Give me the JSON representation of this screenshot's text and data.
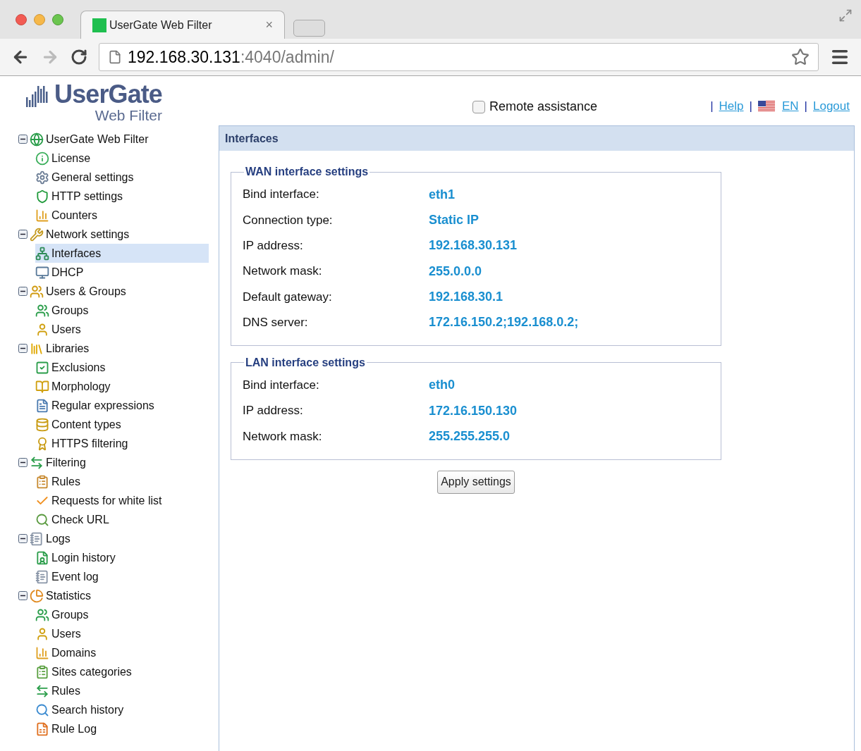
{
  "browser": {
    "tab_title": "UserGate Web Filter",
    "tab_close": "×",
    "url_host": "192.168.30.131",
    "url_rest": ":4040/admin/"
  },
  "logo": {
    "name": "UserGate",
    "subtitle": "Web Filter"
  },
  "header": {
    "remote_assistance": {
      "label": "Remote assistance",
      "checked": false
    },
    "links": [
      {
        "kind": "link",
        "label": "Help"
      },
      {
        "kind": "flag-link",
        "label": "EN"
      },
      {
        "kind": "link",
        "label": "Logout"
      }
    ],
    "separator": "|"
  },
  "tree": [
    {
      "label": "UserGate Web Filter",
      "expanded": true,
      "selected": false,
      "children": [
        {
          "label": "License",
          "selected": false
        },
        {
          "label": "General settings",
          "selected": false
        },
        {
          "label": "HTTP settings",
          "selected": false
        },
        {
          "label": "Counters",
          "selected": false
        }
      ]
    },
    {
      "label": "Network settings",
      "expanded": true,
      "selected": false,
      "children": [
        {
          "label": "Interfaces",
          "selected": true
        },
        {
          "label": "DHCP",
          "selected": false
        }
      ]
    },
    {
      "label": "Users & Groups",
      "expanded": true,
      "selected": false,
      "children": [
        {
          "label": "Groups",
          "selected": false
        },
        {
          "label": "Users",
          "selected": false
        }
      ]
    },
    {
      "label": "Libraries",
      "expanded": true,
      "selected": false,
      "children": [
        {
          "label": "Exclusions",
          "selected": false
        },
        {
          "label": "Morphology",
          "selected": false
        },
        {
          "label": "Regular expressions",
          "selected": false
        },
        {
          "label": "Content types",
          "selected": false
        },
        {
          "label": "HTTPS filtering",
          "selected": false
        }
      ]
    },
    {
      "label": "Filtering",
      "expanded": true,
      "selected": false,
      "children": [
        {
          "label": "Rules",
          "selected": false
        },
        {
          "label": "Requests for white list",
          "selected": false
        },
        {
          "label": "Check URL",
          "selected": false
        }
      ]
    },
    {
      "label": "Logs",
      "expanded": true,
      "selected": false,
      "children": [
        {
          "label": "Login history",
          "selected": false
        },
        {
          "label": "Event log",
          "selected": false
        }
      ]
    },
    {
      "label": "Statistics",
      "expanded": true,
      "selected": false,
      "children": [
        {
          "label": "Groups",
          "selected": false
        },
        {
          "label": "Users",
          "selected": false
        },
        {
          "label": "Domains",
          "selected": false
        },
        {
          "label": "Sites categories",
          "selected": false
        },
        {
          "label": "Rules",
          "selected": false
        },
        {
          "label": "Search history",
          "selected": false
        },
        {
          "label": "Rule Log",
          "selected": false
        }
      ]
    }
  ],
  "page_title": "Interfaces",
  "sections": [
    {
      "title": "WAN interface settings",
      "rows": [
        {
          "label": "Bind interface:",
          "value": "eth1"
        },
        {
          "label": "Connection type:",
          "value": "Static IP"
        },
        {
          "label": "IP address:",
          "value": "192.168.30.131"
        },
        {
          "label": "Network mask:",
          "value": "255.0.0.0"
        },
        {
          "label": "Default gateway:",
          "value": "192.168.30.1"
        },
        {
          "label": "DNS server:",
          "value": "172.16.150.2;192.168.0.2;"
        }
      ]
    },
    {
      "title": "LAN interface settings",
      "rows": [
        {
          "label": "Bind interface:",
          "value": "eth0"
        },
        {
          "label": "IP address:",
          "value": "172.16.150.130"
        },
        {
          "label": "Network mask:",
          "value": "255.255.255.0"
        }
      ]
    }
  ],
  "apply_button": "Apply settings"
}
